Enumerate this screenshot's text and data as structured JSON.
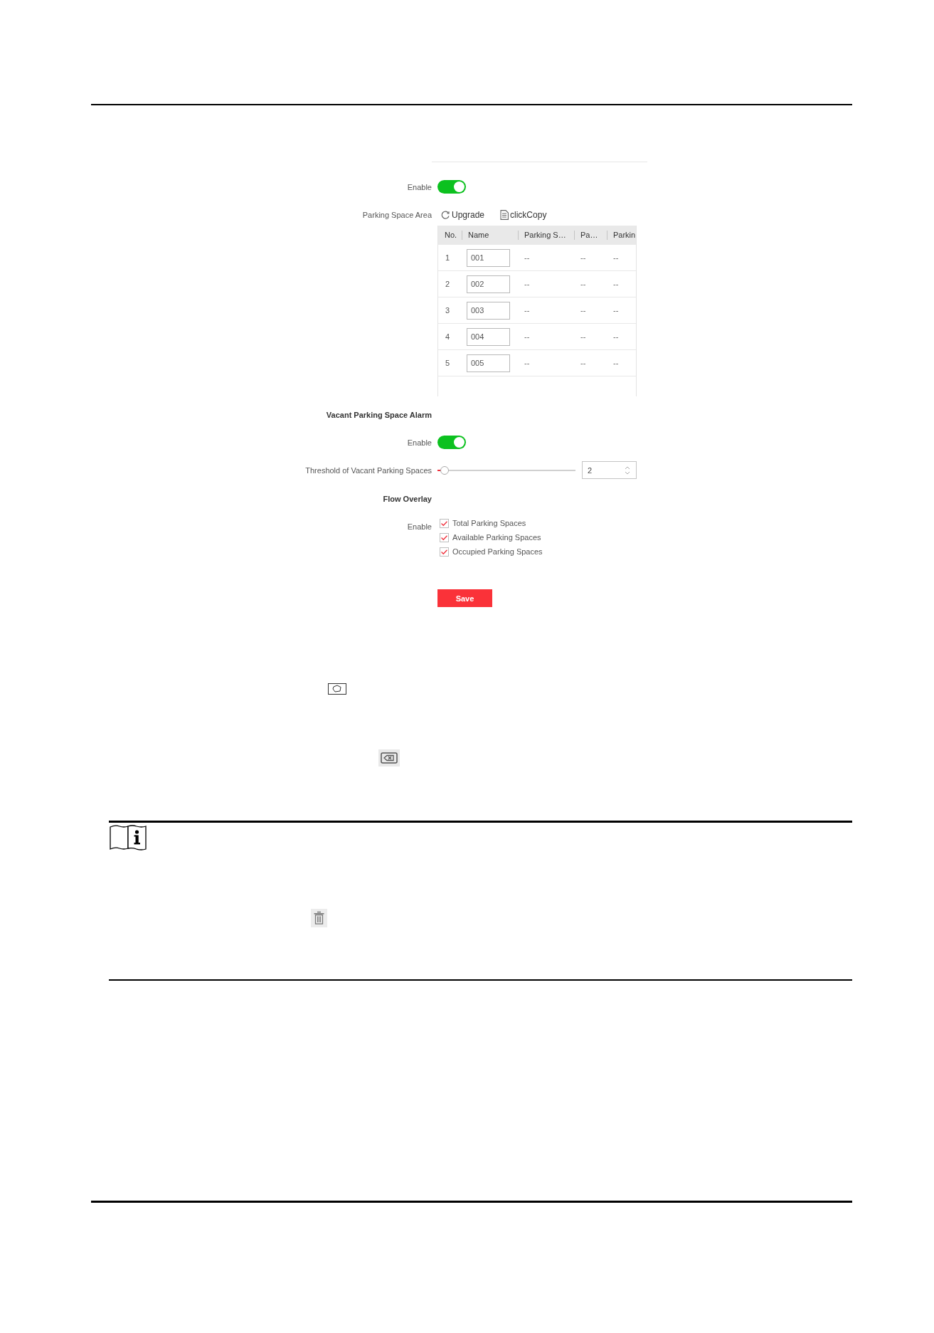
{
  "settings": {
    "enable": {
      "label": "Enable",
      "on": true
    },
    "parking_space_area": {
      "label": "Parking Space Area",
      "actions": [
        {
          "kind": "refresh",
          "label": "Upgrade"
        },
        {
          "kind": "copy",
          "label": "clickCopy"
        }
      ],
      "table": {
        "columns": [
          {
            "label": "No.",
            "kind": "text"
          },
          {
            "label": "Name",
            "kind": "input"
          },
          {
            "label": "Parking S…",
            "kind": "text"
          },
          {
            "label": "Pa…",
            "kind": "text"
          },
          {
            "label": "Parkin",
            "kind": "text"
          }
        ],
        "rows": [
          {
            "cells": [
              "1",
              "001",
              "--",
              "--",
              "--"
            ]
          },
          {
            "cells": [
              "2",
              "002",
              "--",
              "--",
              "--"
            ]
          },
          {
            "cells": [
              "3",
              "003",
              "--",
              "--",
              "--"
            ]
          },
          {
            "cells": [
              "4",
              "004",
              "--",
              "--",
              "--"
            ]
          },
          {
            "cells": [
              "5",
              "005",
              "--",
              "--",
              "--"
            ]
          }
        ]
      }
    },
    "vacant_parking_space_alarm": {
      "title": "Vacant Parking Space Alarm",
      "enable": {
        "label": "Enable",
        "on": true
      },
      "threshold": {
        "label": "Threshold of Vacant Parking Spaces",
        "level": 0.05,
        "value": "2"
      }
    },
    "flow_overlay": {
      "title": "Flow Overlay",
      "label": "Enable",
      "options": [
        {
          "label": "Total Parking Spaces",
          "checked": true
        },
        {
          "label": "Available Parking Spaces",
          "checked": true
        },
        {
          "label": "Occupied Parking Spaces",
          "checked": true
        }
      ]
    },
    "save_button": "Save"
  }
}
